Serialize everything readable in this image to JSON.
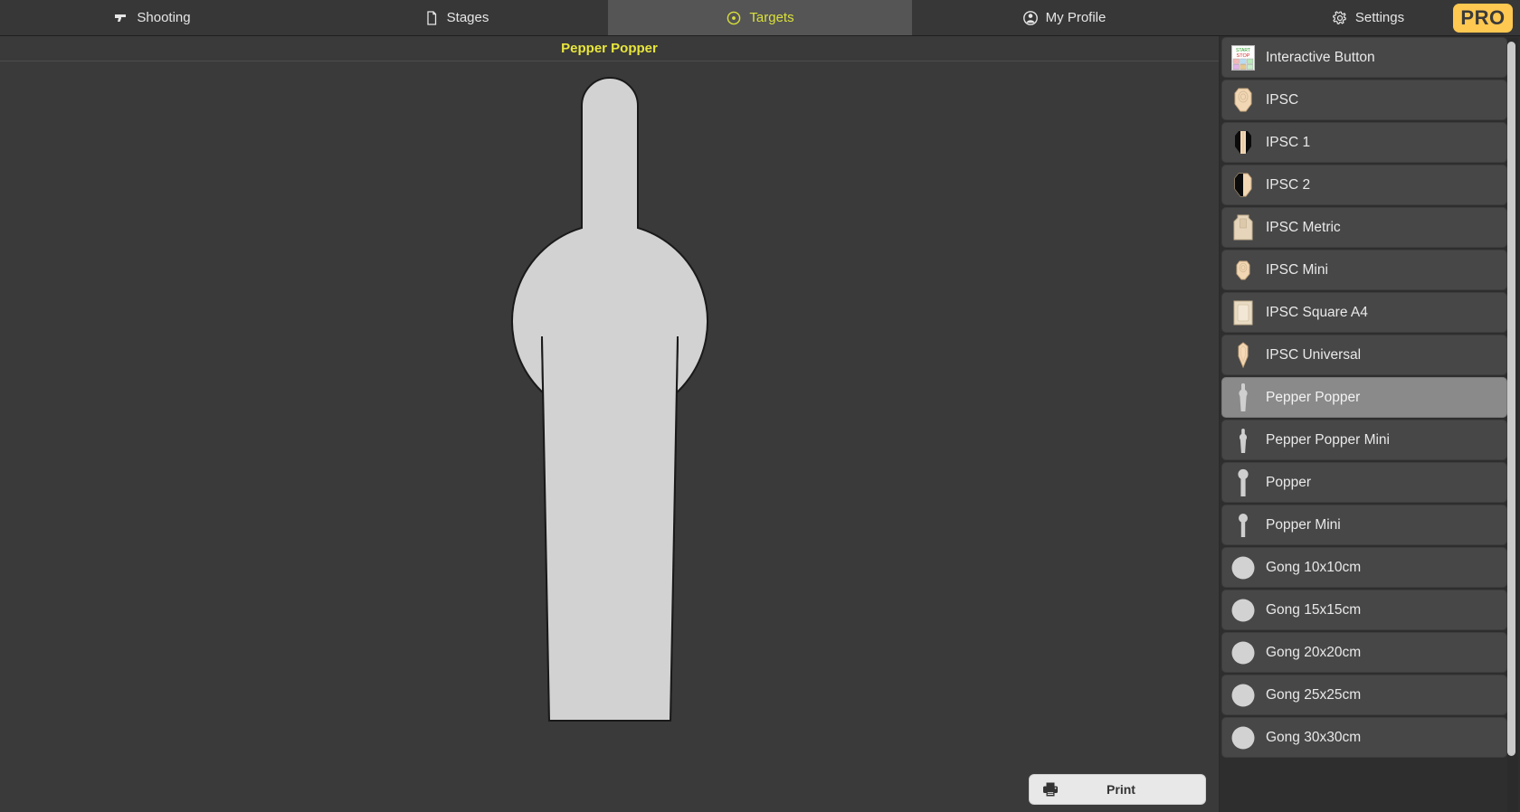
{
  "topnav": {
    "tabs": [
      {
        "label": "Shooting",
        "icon": "pistol-icon",
        "active": false
      },
      {
        "label": "Stages",
        "icon": "document-icon",
        "active": false
      },
      {
        "label": "Targets",
        "icon": "target-icon",
        "active": true
      },
      {
        "label": "My Profile",
        "icon": "user-circle-icon",
        "active": false
      },
      {
        "label": "Settings",
        "icon": "gear-icon",
        "active": false
      }
    ],
    "pro_badge": "PRO",
    "active_color": "#d9e03a",
    "pro_bg": "#ffc850"
  },
  "main": {
    "title": "Pepper Popper",
    "title_color": "#e8e63c",
    "print_label": "Print",
    "print_icon": "printer-icon",
    "target_fill": "#d2d2d2",
    "target_stroke": "#1a1a1a",
    "background": "#3a3a3a"
  },
  "sidebar": {
    "selected": "Pepper Popper",
    "items": [
      {
        "label": "Interactive Button",
        "icon": "interactive-button-icon"
      },
      {
        "label": "IPSC",
        "icon": "ipsc-target-icon"
      },
      {
        "label": "IPSC 1",
        "icon": "ipsc-1-target-icon"
      },
      {
        "label": "IPSC 2",
        "icon": "ipsc-2-target-icon"
      },
      {
        "label": "IPSC Metric",
        "icon": "ipsc-metric-target-icon"
      },
      {
        "label": "IPSC Mini",
        "icon": "ipsc-mini-target-icon"
      },
      {
        "label": "IPSC Square A4",
        "icon": "ipsc-square-a4-icon"
      },
      {
        "label": "IPSC Universal",
        "icon": "ipsc-universal-target-icon"
      },
      {
        "label": "Pepper Popper",
        "icon": "pepper-popper-icon"
      },
      {
        "label": "Pepper Popper Mini",
        "icon": "pepper-popper-mini-icon"
      },
      {
        "label": "Popper",
        "icon": "popper-icon"
      },
      {
        "label": "Popper Mini",
        "icon": "popper-mini-icon"
      },
      {
        "label": "Gong 10x10cm",
        "icon": "gong-circle-icon"
      },
      {
        "label": "Gong 15x15cm",
        "icon": "gong-circle-icon"
      },
      {
        "label": "Gong 20x20cm",
        "icon": "gong-circle-icon"
      },
      {
        "label": "Gong 25x25cm",
        "icon": "gong-circle-icon"
      },
      {
        "label": "Gong 30x30cm",
        "icon": "gong-circle-icon"
      }
    ]
  }
}
